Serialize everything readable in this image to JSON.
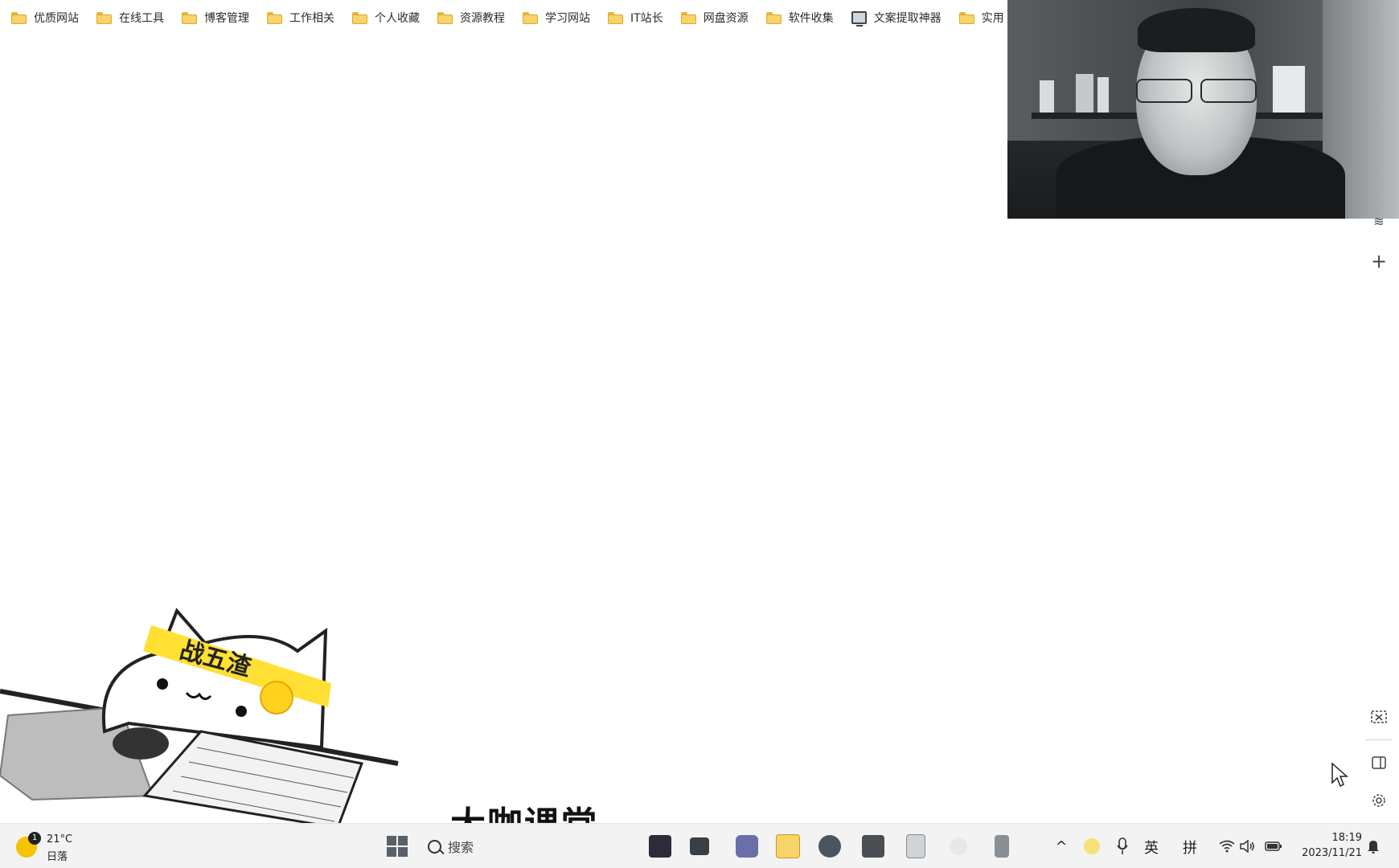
{
  "bookmarks": [
    {
      "label": "优质网站",
      "icon": "folder-icon"
    },
    {
      "label": "在线工具",
      "icon": "folder-icon"
    },
    {
      "label": "博客管理",
      "icon": "folder-icon"
    },
    {
      "label": "工作相关",
      "icon": "folder-icon"
    },
    {
      "label": "个人收藏",
      "icon": "folder-icon"
    },
    {
      "label": "资源教程",
      "icon": "folder-icon"
    },
    {
      "label": "学习网站",
      "icon": "folder-icon"
    },
    {
      "label": "IT站长",
      "icon": "folder-icon"
    },
    {
      "label": "网盘资源",
      "icon": "folder-icon"
    },
    {
      "label": "软件收集",
      "icon": "folder-icon"
    },
    {
      "label": "文案提取神器",
      "icon": "monitor-icon"
    },
    {
      "label": "实用",
      "icon": "folder-icon"
    }
  ],
  "cat_sticker": {
    "headband_text": "战五渣"
  },
  "brand": {
    "title": "大咖课堂"
  },
  "taskbar": {
    "weather": {
      "temp": "21°C",
      "condition": "日落",
      "badge": "1"
    },
    "search_placeholder": "搜索",
    "tray": {
      "lang_en": "英",
      "lang_pinyin": "拼"
    },
    "clock": {
      "time": "18:19",
      "date": "2023/11/21"
    }
  },
  "colors": {
    "folder": "#f7d46a",
    "taskbar_bg": "#f3f3f3",
    "accent": "#f5c400"
  }
}
